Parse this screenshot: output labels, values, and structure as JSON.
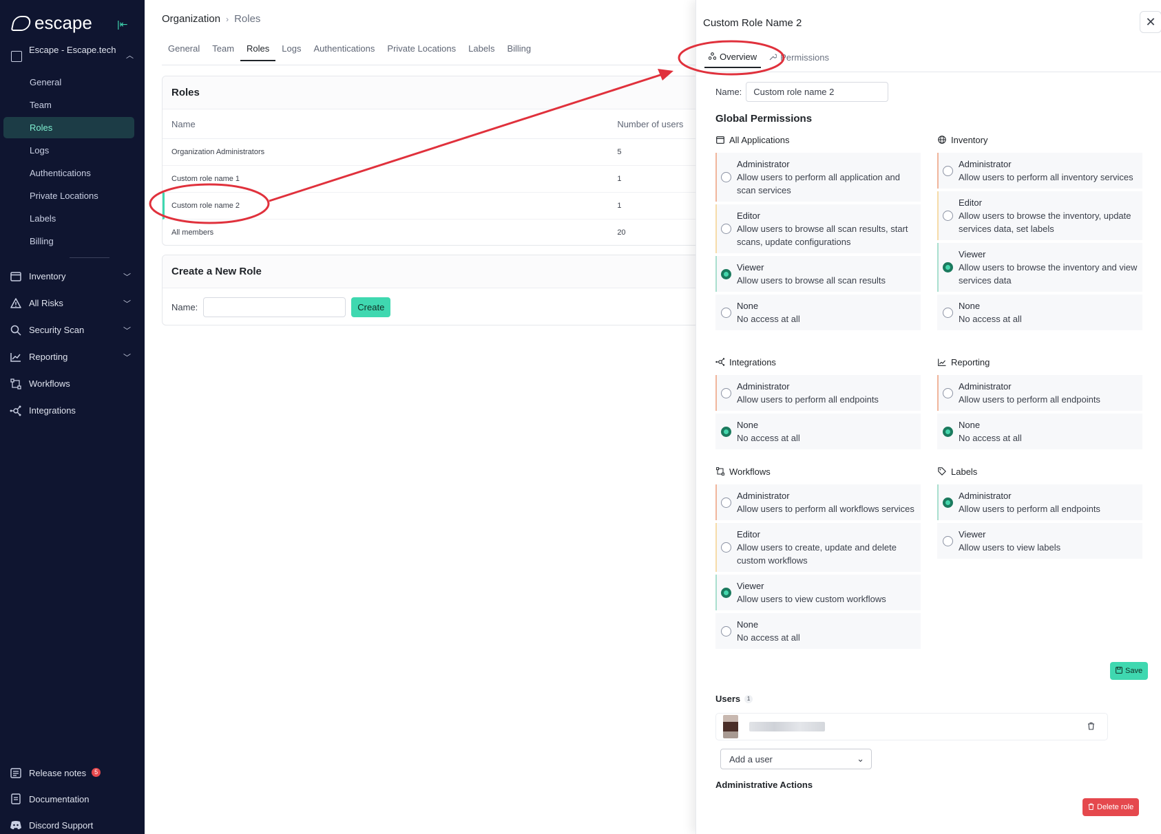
{
  "app": {
    "logo_text": "escape",
    "colors": {
      "sidebar_bg": "#0f1530",
      "accent": "#3fd8b0",
      "danger": "#e5484d",
      "annotation": "#e0313c"
    }
  },
  "sidebar": {
    "org_name": "Escape - Escape.tech",
    "org_items": [
      {
        "label": "General"
      },
      {
        "label": "Team"
      },
      {
        "label": "Roles"
      },
      {
        "label": "Logs"
      },
      {
        "label": "Authentications"
      },
      {
        "label": "Private Locations"
      },
      {
        "label": "Labels"
      },
      {
        "label": "Billing"
      }
    ],
    "nav": [
      {
        "label": "Inventory",
        "icon": "window-icon"
      },
      {
        "label": "All Risks",
        "icon": "warning-icon"
      },
      {
        "label": "Security Scan",
        "icon": "search-icon"
      },
      {
        "label": "Reporting",
        "icon": "chart-icon"
      },
      {
        "label": "Workflows",
        "icon": "workflow-icon"
      },
      {
        "label": "Integrations",
        "icon": "integrations-icon"
      }
    ],
    "bottom": [
      {
        "label": "Release notes",
        "badge": "5"
      },
      {
        "label": "Documentation"
      },
      {
        "label": "Discord Support"
      }
    ]
  },
  "breadcrumb": {
    "root": "Organization",
    "current": "Roles"
  },
  "tabs": [
    "General",
    "Team",
    "Roles",
    "Logs",
    "Authentications",
    "Private Locations",
    "Labels",
    "Billing"
  ],
  "roles_card": {
    "title": "Roles",
    "columns": {
      "name": "Name",
      "users": "Number of users"
    },
    "rows": [
      {
        "name": "Organization Administrators",
        "users": "5"
      },
      {
        "name": "Custom role name 1",
        "users": "1"
      },
      {
        "name": "Custom role name 2",
        "users": "1"
      },
      {
        "name": "All members",
        "users": "20"
      }
    ]
  },
  "create_card": {
    "title": "Create a New Role",
    "name_label": "Name:",
    "button": "Create"
  },
  "drawer": {
    "title": "Custom Role Name 2",
    "tabs": {
      "overview": "Overview",
      "permissions": "Permissions"
    },
    "name_label": "Name:",
    "name_value": "Custom role name 2",
    "global_permissions": "Global Permissions",
    "groups": {
      "all_apps": {
        "title": "All Applications",
        "options": [
          {
            "title": "Administrator",
            "desc": "Allow users to perform all application and scan services"
          },
          {
            "title": "Editor",
            "desc": "Allow users to browse all scan results, start scans, update configurations"
          },
          {
            "title": "Viewer",
            "desc": "Allow users to browse all scan results"
          },
          {
            "title": "None",
            "desc": "No access at all"
          }
        ]
      },
      "inventory": {
        "title": "Inventory",
        "options": [
          {
            "title": "Administrator",
            "desc": "Allow users to perform all inventory services"
          },
          {
            "title": "Editor",
            "desc": "Allow users to browse the inventory, update services data, set labels"
          },
          {
            "title": "Viewer",
            "desc": "Allow users to browse the inventory and view services data"
          },
          {
            "title": "None",
            "desc": "No access at all"
          }
        ]
      },
      "integrations": {
        "title": "Integrations",
        "options": [
          {
            "title": "Administrator",
            "desc": "Allow users to perform all endpoints"
          },
          {
            "title": "None",
            "desc": "No access at all"
          }
        ]
      },
      "reporting": {
        "title": "Reporting",
        "options": [
          {
            "title": "Administrator",
            "desc": "Allow users to perform all endpoints"
          },
          {
            "title": "None",
            "desc": "No access at all"
          }
        ]
      },
      "workflows": {
        "title": "Workflows",
        "options": [
          {
            "title": "Administrator",
            "desc": "Allow users to perform all workflows services"
          },
          {
            "title": "Editor",
            "desc": "Allow users to create, update and delete custom workflows"
          },
          {
            "title": "Viewer",
            "desc": "Allow users to view custom workflows"
          },
          {
            "title": "None",
            "desc": "No access at all"
          }
        ]
      },
      "labels": {
        "title": "Labels",
        "options": [
          {
            "title": "Administrator",
            "desc": "Allow users to perform all endpoints"
          },
          {
            "title": "Viewer",
            "desc": "Allow users to view labels"
          }
        ]
      }
    },
    "save": "Save",
    "users_title": "Users",
    "users_count": "1",
    "add_user": "Add a user",
    "admin_actions": "Administrative Actions",
    "delete": "Delete role"
  }
}
